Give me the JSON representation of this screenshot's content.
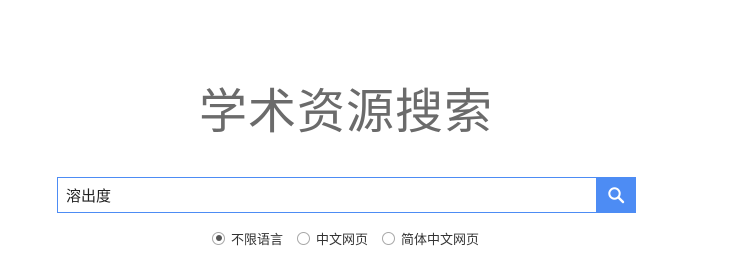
{
  "title": "学术资源搜索",
  "search": {
    "value": "溶出度",
    "placeholder": ""
  },
  "language_options": [
    {
      "label": "不限语言",
      "selected": true
    },
    {
      "label": "中文网页",
      "selected": false
    },
    {
      "label": "简体中文网页",
      "selected": false
    }
  ],
  "colors": {
    "accent": "#4d8cf4",
    "title": "#6b6b6b"
  },
  "icons": {
    "search_button": "search-icon"
  }
}
